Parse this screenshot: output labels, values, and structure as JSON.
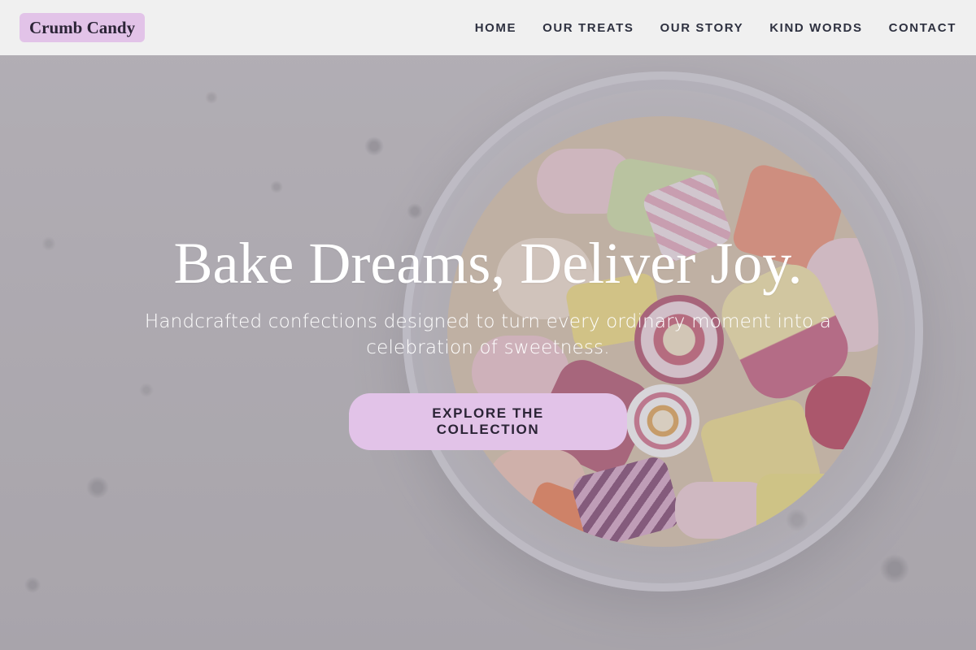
{
  "brand": {
    "name": "Crumb Candy",
    "accent_color": "#e2c3e8"
  },
  "nav": {
    "items": [
      {
        "label": "HOME"
      },
      {
        "label": "OUR TREATS"
      },
      {
        "label": "OUR STORY"
      },
      {
        "label": "KIND WORDS"
      },
      {
        "label": "CONTACT"
      }
    ]
  },
  "hero": {
    "title": "Bake Dreams, Deliver Joy.",
    "subtitle": "Handcrafted confections designed to turn every ordinary moment into a celebration of sweetness.",
    "cta_label": "EXPLORE THE COLLECTION",
    "background_image": "candy-jar-photo"
  }
}
